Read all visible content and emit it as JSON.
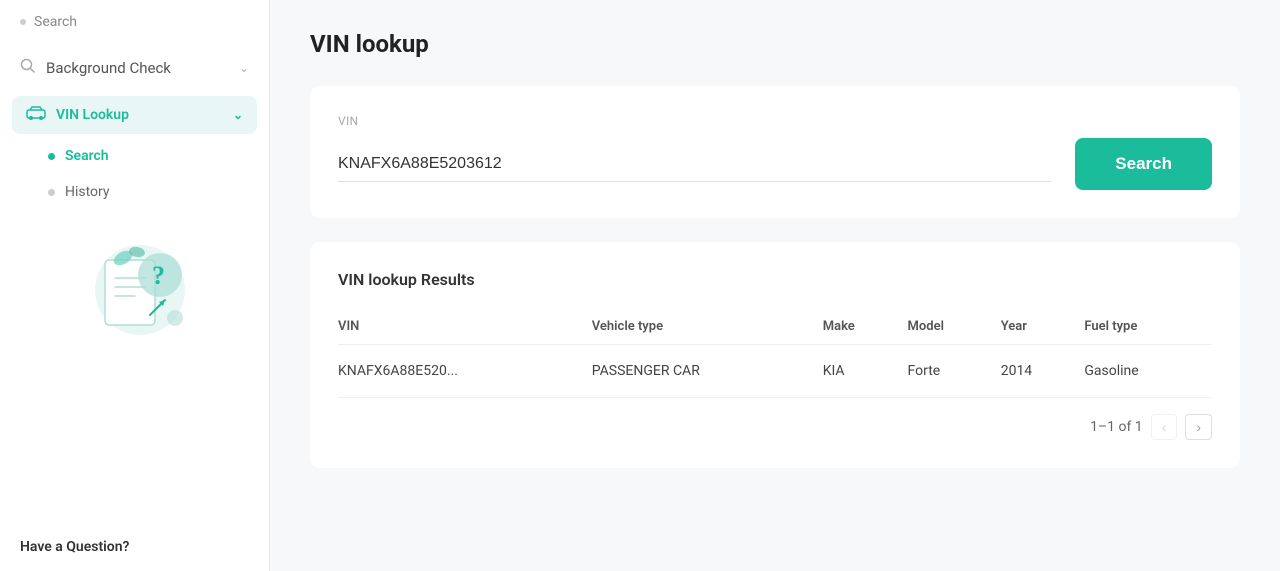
{
  "sidebar": {
    "top_search_label": "Search",
    "background_check_label": "Background Check",
    "vin_lookup_label": "VIN Lookup",
    "sub_items": [
      {
        "label": "Search",
        "active": true
      },
      {
        "label": "History",
        "active": false
      }
    ],
    "footer_text": "Have a Question?"
  },
  "main": {
    "page_title": "VIN lookup",
    "vin_label": "VIN",
    "vin_value": "KNAFX6A88E5203612",
    "search_button_label": "Search",
    "results_title": "VIN lookup Results",
    "table": {
      "headers": [
        "VIN",
        "Vehicle type",
        "Make",
        "Model",
        "Year",
        "Fuel type"
      ],
      "rows": [
        {
          "vin": "KNAFX6A88E520...",
          "vehicle_type": "PASSENGER CAR",
          "make": "KIA",
          "model": "Forte",
          "year": "2014",
          "fuel_type": "Gasoline"
        }
      ]
    },
    "pagination": {
      "label": "1–1 of 1"
    }
  },
  "colors": {
    "accent": "#1abc9c",
    "active_bg": "#e8f7f5"
  }
}
